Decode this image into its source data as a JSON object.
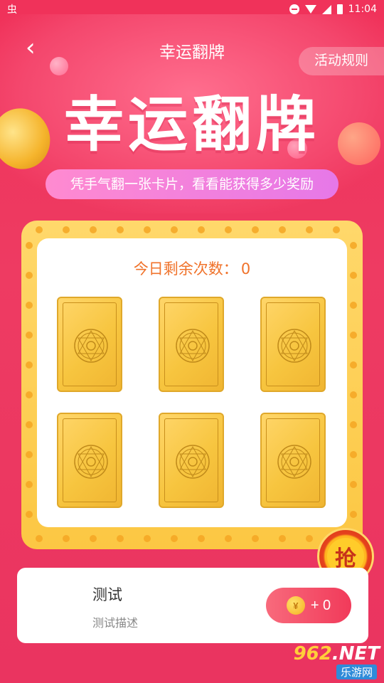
{
  "status_bar": {
    "app_glyph": "虫",
    "time": "11:04"
  },
  "header": {
    "title": "幸运翻牌",
    "rules_label": "活动规则"
  },
  "hero": {
    "big_title": "幸运翻牌",
    "subtitle": "凭手气翻一张卡片，看看能获得多少奖励"
  },
  "game": {
    "remaining_label": "今日剩余次数：",
    "remaining_count": "0",
    "cards": [
      "card-1",
      "card-2",
      "card-3",
      "card-4",
      "card-5",
      "card-6"
    ]
  },
  "grab_badge": {
    "label": "抢"
  },
  "task": {
    "title": "测试",
    "description": "测试描述",
    "reward": "+ 0",
    "coin_symbol": "¥"
  },
  "watermark": {
    "main_prefix": "962",
    "main_suffix": ".NET",
    "sub": "乐游网"
  },
  "colors": {
    "accent": "#f0325a",
    "gold": "#fcc743",
    "count": "#f0722a"
  }
}
